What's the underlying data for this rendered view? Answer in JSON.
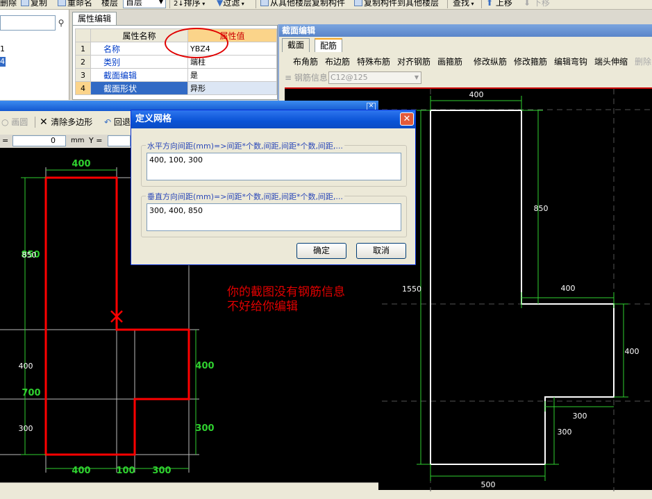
{
  "toolbar": {
    "delete": "删除",
    "copy": "复制",
    "rename": "重命名",
    "floor_label": "楼层",
    "floor_value": "首层",
    "sort": "排序",
    "filter": "过滤",
    "copy_from_floor": "从其他楼层复制构件",
    "copy_to_floor": "复制构件到其他楼层",
    "find": "查找",
    "move_up": "上移",
    "move_down": "下移"
  },
  "left_tree": {
    "item_a": "1",
    "item_b": "4"
  },
  "properties": {
    "tab": "属性编辑",
    "header_name": "属性名称",
    "header_value": "属性值",
    "rows": [
      {
        "no": "1",
        "name": "名称",
        "value": "YBZ4"
      },
      {
        "no": "2",
        "name": "类别",
        "value": "端柱"
      },
      {
        "no": "3",
        "name": "截面编辑",
        "value": "是"
      },
      {
        "no": "4",
        "name": "截面形状",
        "value": "异形"
      }
    ]
  },
  "left_window": {
    "tool_circle": "画圆",
    "tool_clear": "清除多边形",
    "tool_undo": "回退",
    "x_label": "=",
    "x_value": "0",
    "unit": "mm",
    "y_label": "Y ="
  },
  "left_drawing": {
    "top_dim": "400",
    "left_dim_total": "850",
    "left_dim_overlap": "850",
    "left_dim_a": "400",
    "left_dim_b": "700",
    "left_dim_c": "300",
    "right_dim_a": "400",
    "right_dim_b": "300",
    "bottom_dims": [
      "400",
      "100",
      "300"
    ]
  },
  "section_window": {
    "title": "截面编辑",
    "tabs": [
      "截面",
      "配筋"
    ],
    "rebar_tools": [
      "布角筋",
      "布边筋",
      "特殊布筋",
      "对齐钢筋",
      "画箍筋",
      "修改纵筋",
      "修改箍筋",
      "编辑弯钩",
      "端头伸缩",
      "删除"
    ],
    "steel_info_label": "钢筋信息",
    "steel_info_value": "C12@125"
  },
  "right_drawing": {
    "dims": {
      "top": "400",
      "upper_right": "850",
      "left": "1550",
      "mid_horizontal": "400",
      "right_vertical": "400",
      "step_horizontal": "300",
      "step_vertical": "300",
      "bottom": "500"
    }
  },
  "dialog": {
    "title": "定义网格",
    "h_label": "水平方向间距(mm)=>间距*个数,间距,间距*个数,间距,...",
    "h_value": "400, 100, 300",
    "v_label": "垂直方向间距(mm)=>间距*个数,间距,间距*个数,间距,...",
    "v_value": "300, 400, 850",
    "ok": "确定",
    "cancel": "取消"
  },
  "annotation": {
    "line1": "你的截图没有钢筋信息",
    "line2": "不好给你编辑"
  },
  "colors": {
    "outline_red": "#ff0000",
    "dim_green": "#00cc00",
    "grid_white": "#ffffff",
    "note_red": "#e00000"
  }
}
